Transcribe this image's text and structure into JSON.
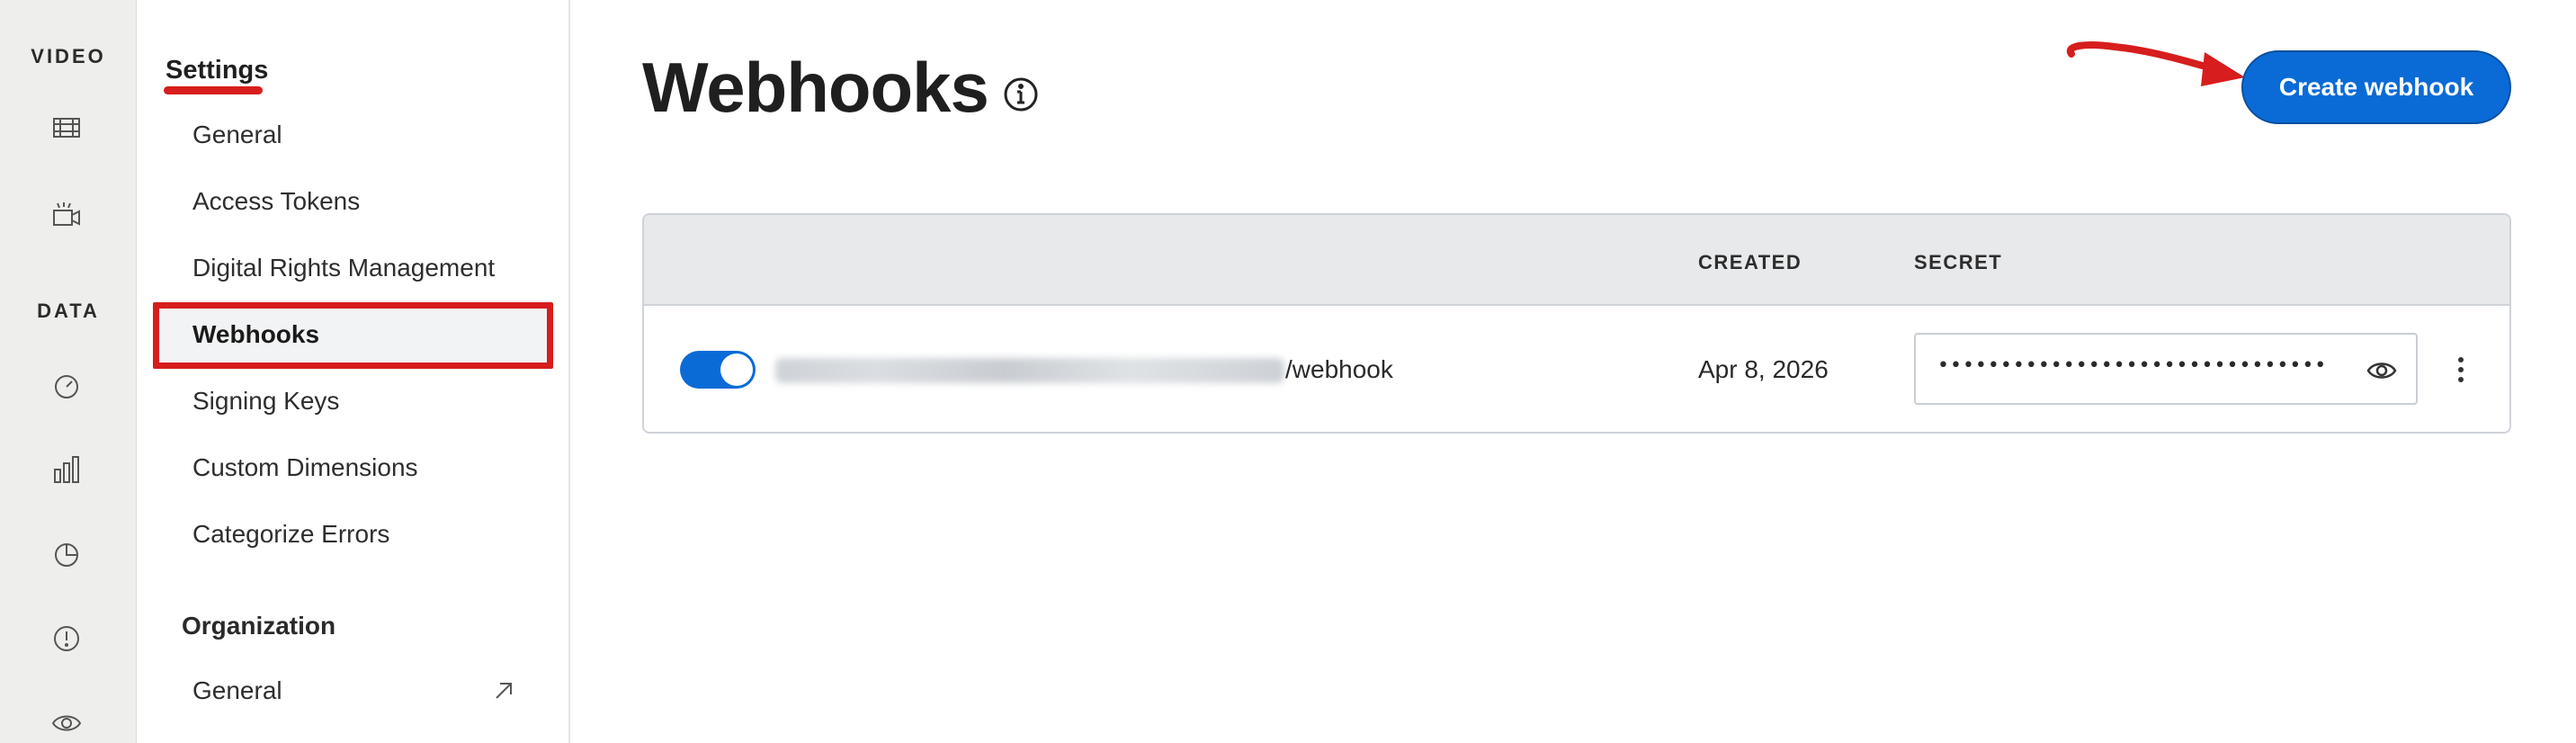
{
  "rail": {
    "video_label": "VIDEO",
    "data_label": "DATA",
    "icons": [
      "film-icon",
      "camera-icon",
      "gauge-icon",
      "bar-chart-icon",
      "pie-chart-icon",
      "alert-icon",
      "eye-icon"
    ]
  },
  "settings_nav": {
    "heading": "Settings",
    "items": [
      {
        "label": "General"
      },
      {
        "label": "Access Tokens"
      },
      {
        "label": "Digital Rights Management"
      },
      {
        "label": "Webhooks",
        "active": true
      },
      {
        "label": "Signing Keys"
      },
      {
        "label": "Custom Dimensions"
      },
      {
        "label": "Categorize Errors"
      }
    ],
    "organization_heading": "Organization",
    "org_items": [
      {
        "label": "General",
        "external": true
      }
    ]
  },
  "main": {
    "title": "Webhooks",
    "create_button": "Create webhook",
    "table": {
      "columns": [
        "",
        "CREATED",
        "SECRET"
      ],
      "rows": [
        {
          "enabled": true,
          "url_suffix": "/webhook",
          "created": "Apr 8, 2026",
          "secret_masked": "•••••••••••••••••••••••••••••••"
        }
      ]
    }
  },
  "colors": {
    "accent": "#0a6bd6",
    "annotation_red": "#d71d1d",
    "rail_bg": "#eeeeec",
    "table_header_bg": "#e8e9eb"
  }
}
